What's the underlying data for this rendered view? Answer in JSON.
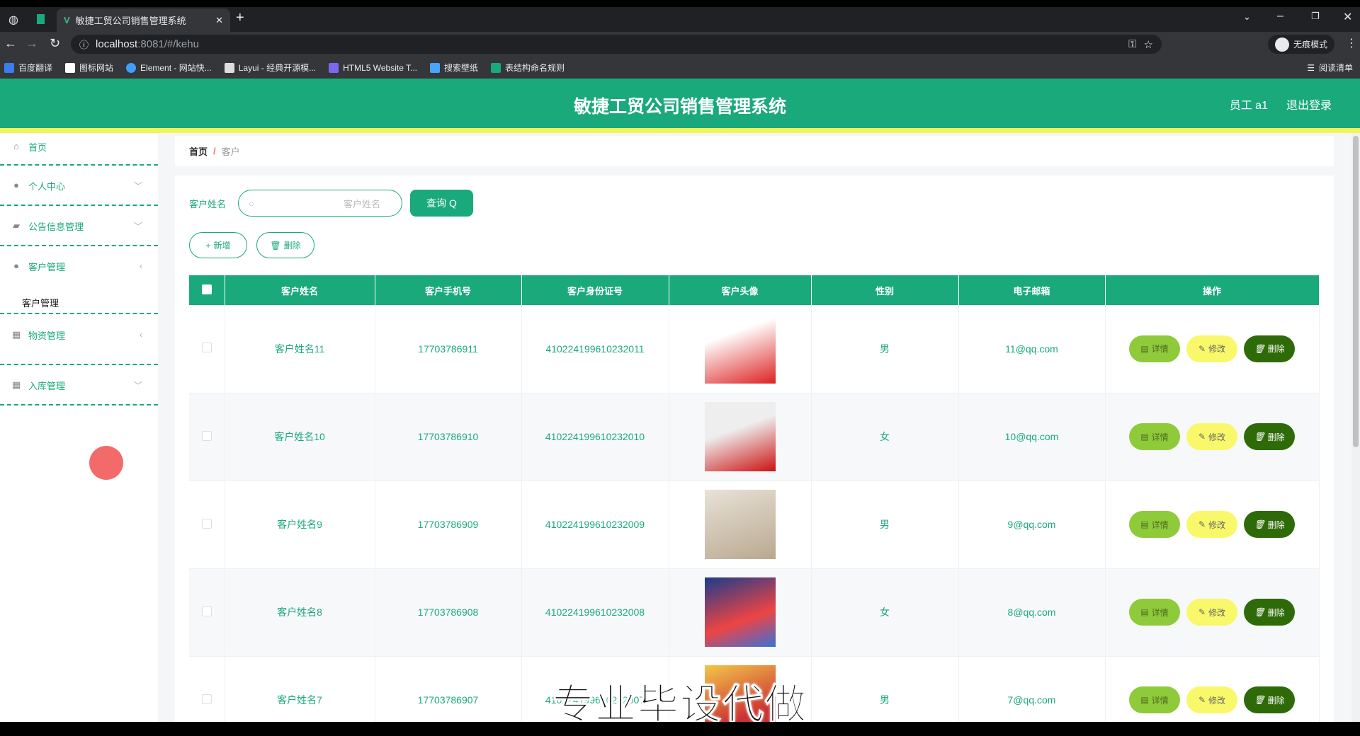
{
  "browser": {
    "tab_title": "敏捷工贸公司销售管理系统",
    "url_host": "localhost",
    "url_rest": ":8081/#/kehu",
    "incognito": "无痕模式",
    "reading_list": "阅读清单",
    "bookmarks": [
      {
        "label": "百度翻译",
        "color": "#3b7cf0"
      },
      {
        "label": "图标网站",
        "color": "#fff"
      },
      {
        "label": "Element - 网站快...",
        "color": "#409eff"
      },
      {
        "label": "Layui - 经典开源模...",
        "color": "#ddd"
      },
      {
        "label": "HTML5 Website T...",
        "color": "#7b68ee"
      },
      {
        "label": "搜索壁纸",
        "color": "#4aa3ff"
      },
      {
        "label": "表结构命名规则",
        "color": "#1aa97b"
      }
    ]
  },
  "header": {
    "title": "敏捷工贸公司销售管理系统",
    "user": "员工 a1",
    "logout": "退出登录"
  },
  "sidebar": {
    "items": [
      {
        "label": "首页",
        "icon": "home-icon"
      },
      {
        "label": "个人中心",
        "icon": "user-icon"
      },
      {
        "label": "公告信息管理",
        "icon": "notice-icon"
      },
      {
        "label": "客户管理",
        "icon": "customer-icon",
        "sub": "客户管理"
      },
      {
        "label": "物资管理",
        "icon": "grid-icon"
      },
      {
        "label": "入库管理",
        "icon": "warehouse-icon"
      }
    ]
  },
  "breadcrumb": {
    "home": "首页",
    "sep": "/",
    "current": "客户"
  },
  "search": {
    "label": "客户姓名",
    "placeholder": "客户姓名",
    "button": "查询"
  },
  "actions": {
    "add": "新增",
    "delete": "删除"
  },
  "table": {
    "headers": [
      "客户姓名",
      "客户手机号",
      "客户身份证号",
      "客户头像",
      "性别",
      "电子邮箱",
      "操作"
    ],
    "rows": [
      {
        "name": "客户姓名11",
        "phone": "17703786911",
        "id": "410224199610232011",
        "gender": "男",
        "email": "11@qq.com"
      },
      {
        "name": "客户姓名10",
        "phone": "17703786910",
        "id": "410224199610232010",
        "gender": "女",
        "email": "10@qq.com"
      },
      {
        "name": "客户姓名9",
        "phone": "17703786909",
        "id": "410224199610232009",
        "gender": "男",
        "email": "9@qq.com"
      },
      {
        "name": "客户姓名8",
        "phone": "17703786908",
        "id": "410224199610232008",
        "gender": "女",
        "email": "8@qq.com"
      },
      {
        "name": "客户姓名7",
        "phone": "17703786907",
        "id": "410224199610232007",
        "gender": "男",
        "email": "7@qq.com"
      }
    ],
    "row_actions": {
      "detail": "详情",
      "edit": "修改",
      "delete": "删除"
    }
  },
  "watermark": "专业毕设代做"
}
